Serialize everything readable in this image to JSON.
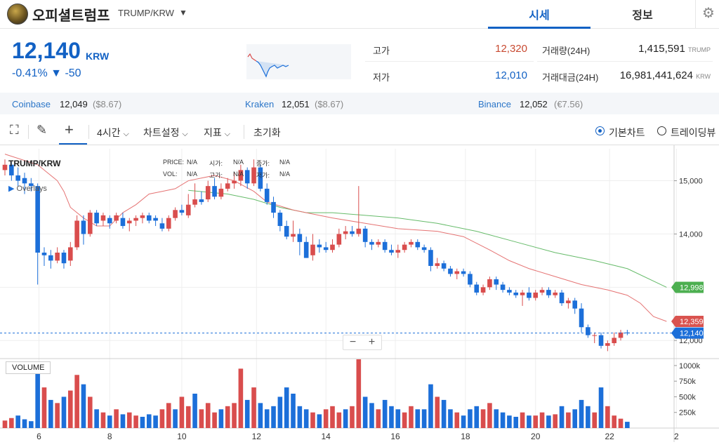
{
  "header": {
    "coin_name": "오피셜트럼프",
    "pair": "TRUMP/KRW",
    "tabs": [
      "시세",
      "정보"
    ]
  },
  "price": {
    "value": "12,140",
    "unit": "KRW",
    "change_pct": "-0.41%",
    "change_amt": "▼ -50"
  },
  "stats": {
    "high_label": "고가",
    "high": "12,320",
    "low_label": "저가",
    "low": "12,010",
    "vol_label": "거래량(24H)",
    "vol": "1,415,591",
    "vol_unit": "TRUMP",
    "amt_label": "거래대금(24H)",
    "amt": "16,981,441,624",
    "amt_unit": "KRW"
  },
  "exchanges": [
    {
      "name": "Coinbase",
      "price": "12,049",
      "usd": "($8.67)"
    },
    {
      "name": "Kraken",
      "price": "12,051",
      "usd": "($8.67)"
    },
    {
      "name": "Binance",
      "price": "12,052",
      "usd": "(€7.56)"
    }
  ],
  "toolbar": {
    "interval": "4시간",
    "chart_settings": "차트설정",
    "indicators": "지표",
    "reset": "초기화",
    "basic_chart": "기본차트",
    "trading_view": "트레이딩뷰"
  },
  "chart_overlay": {
    "pair": "TRUMP/KRW",
    "overlays": "Overlays",
    "price_label": "PRICE:",
    "price_val": "N/A",
    "open_label": "시가:",
    "open_val": "N/A",
    "close_label": "종가:",
    "close_val": "N/A",
    "vol_label": "VOL:",
    "vol_val": "N/A",
    "high_label": "고가:",
    "high_val": "N/A",
    "low_label": "저가:",
    "low_val": "N/A",
    "volume_title": "VOLUME",
    "zoom_minus": "−",
    "zoom_plus": "+"
  },
  "colors": {
    "up": "#d94d4d",
    "down": "#1c6fd9",
    "ma_short": "#e57373",
    "ma_long": "#66bb6a",
    "accent": "#1261c4"
  },
  "chart_data": {
    "type": "candlestick",
    "x_ticks": [
      "6",
      "8",
      "10",
      "12",
      "14",
      "16",
      "18",
      "20",
      "22",
      "2"
    ],
    "y_ticks": [
      "15,000",
      "14,000",
      "12,000"
    ],
    "volume_ticks": [
      "1000k",
      "750k",
      "500k",
      "250k"
    ],
    "ylim": [
      11700,
      15600
    ],
    "markers": {
      "ma_long": "12,998",
      "ma_short": "12,359",
      "current": "12,140"
    },
    "ma_short_points": [
      [
        0,
        15500
      ],
      [
        5,
        15300
      ],
      [
        8,
        15000
      ],
      [
        9,
        14800
      ],
      [
        10,
        14500
      ],
      [
        12,
        14300
      ],
      [
        14,
        14150
      ],
      [
        16,
        14150
      ],
      [
        18,
        14400
      ],
      [
        20,
        14550
      ],
      [
        22,
        14750
      ],
      [
        24,
        14800
      ],
      [
        26,
        14850
      ],
      [
        28,
        15000
      ],
      [
        32,
        15100
      ],
      [
        35,
        15000
      ],
      [
        38,
        14800
      ],
      [
        40,
        14600
      ],
      [
        44,
        14450
      ],
      [
        46,
        14400
      ],
      [
        50,
        14300
      ],
      [
        55,
        14200
      ],
      [
        60,
        14100
      ],
      [
        66,
        14050
      ],
      [
        70,
        13950
      ],
      [
        74,
        13700
      ],
      [
        77,
        13500
      ],
      [
        80,
        13350
      ],
      [
        84,
        13200
      ],
      [
        88,
        13050
      ],
      [
        92,
        12950
      ],
      [
        95,
        12850
      ],
      [
        97,
        12700
      ],
      [
        99,
        12450
      ],
      [
        101,
        12359
      ]
    ],
    "ma_long_points": [
      [
        28,
        14820
      ],
      [
        34,
        14750
      ],
      [
        38,
        14650
      ],
      [
        42,
        14500
      ],
      [
        46,
        14400
      ],
      [
        50,
        14400
      ],
      [
        55,
        14350
      ],
      [
        60,
        14300
      ],
      [
        66,
        14200
      ],
      [
        72,
        14050
      ],
      [
        78,
        13850
      ],
      [
        84,
        13650
      ],
      [
        90,
        13500
      ],
      [
        95,
        13350
      ],
      [
        101,
        12998
      ]
    ],
    "candles": [
      [
        15200,
        15300,
        15400,
        15100
      ],
      [
        15300,
        15100,
        15350,
        15000
      ],
      [
        15100,
        15000,
        15250,
        14900
      ],
      [
        15050,
        14950,
        15150,
        14750
      ],
      [
        14950,
        14900,
        15050,
        14800
      ],
      [
        14900,
        13650,
        14950,
        13050
      ],
      [
        13650,
        13600,
        13750,
        13400
      ],
      [
        13600,
        13500,
        13700,
        13350
      ],
      [
        13500,
        13650,
        13750,
        13450
      ],
      [
        13650,
        13450,
        13700,
        13350
      ],
      [
        13500,
        13750,
        13850,
        13400
      ],
      [
        13750,
        14250,
        14350,
        13700
      ],
      [
        14250,
        14000,
        14350,
        13800
      ],
      [
        14000,
        14400,
        14450,
        13950
      ],
      [
        14400,
        14200,
        14450,
        14150
      ],
      [
        14250,
        14350,
        14400,
        14150
      ],
      [
        14300,
        14200,
        14350,
        14100
      ],
      [
        14250,
        14350,
        14400,
        14200
      ],
      [
        14300,
        14150,
        14400,
        14100
      ],
      [
        14200,
        14250,
        14300,
        14050
      ],
      [
        14250,
        14300,
        14350,
        14150
      ],
      [
        14300,
        14350,
        14400,
        14200
      ],
      [
        14350,
        14250,
        14400,
        14200
      ],
      [
        14300,
        14250,
        14350,
        14150
      ],
      [
        14200,
        14100,
        14300,
        14050
      ],
      [
        14100,
        14300,
        14350,
        14050
      ],
      [
        14300,
        14450,
        14500,
        14250
      ],
      [
        14450,
        14400,
        14550,
        14350
      ],
      [
        14350,
        14550,
        14750,
        14300
      ],
      [
        14550,
        14650,
        14950,
        14500
      ],
      [
        14650,
        14600,
        14800,
        14550
      ],
      [
        14650,
        14900,
        15000,
        14600
      ],
      [
        14900,
        14700,
        15050,
        14650
      ],
      [
        14700,
        14850,
        14950,
        14650
      ],
      [
        14850,
        14950,
        15050,
        14800
      ],
      [
        14950,
        15000,
        15150,
        14850
      ],
      [
        15000,
        15200,
        15300,
        14900
      ],
      [
        15200,
        14950,
        15250,
        14850
      ],
      [
        14950,
        15250,
        15400,
        14900
      ],
      [
        15250,
        14850,
        15300,
        14800
      ],
      [
        14850,
        14600,
        14950,
        14550
      ],
      [
        14600,
        14400,
        14700,
        14300
      ],
      [
        14400,
        14150,
        14450,
        14050
      ],
      [
        14150,
        13950,
        14250,
        13900
      ],
      [
        13950,
        14000,
        14250,
        13850
      ],
      [
        14000,
        13850,
        14100,
        13600
      ],
      [
        13850,
        13550,
        13950,
        13550
      ],
      [
        13600,
        13800,
        14000,
        13500
      ],
      [
        13800,
        13750,
        13900,
        13650
      ],
      [
        13750,
        13700,
        13850,
        13650
      ],
      [
        13700,
        13800,
        13900,
        13650
      ],
      [
        13800,
        14000,
        14100,
        13750
      ],
      [
        14000,
        14050,
        14150,
        13900
      ],
      [
        14050,
        14000,
        14150,
        13950
      ],
      [
        14000,
        14100,
        14900,
        13950
      ],
      [
        14100,
        13850,
        14150,
        13750
      ],
      [
        13850,
        13800,
        13900,
        13700
      ],
      [
        13800,
        13850,
        13900,
        13750
      ],
      [
        13850,
        13700,
        13900,
        13650
      ],
      [
        13700,
        13650,
        13800,
        13600
      ],
      [
        13650,
        13700,
        13800,
        13550
      ],
      [
        13700,
        13800,
        13850,
        13650
      ],
      [
        13800,
        13850,
        13900,
        13750
      ],
      [
        13850,
        13750,
        13900,
        13700
      ],
      [
        13750,
        13700,
        13800,
        13650
      ],
      [
        13700,
        13400,
        13750,
        13300
      ],
      [
        13400,
        13450,
        13550,
        13350
      ],
      [
        13450,
        13350,
        13500,
        13300
      ],
      [
        13350,
        13250,
        13400,
        13200
      ],
      [
        13250,
        13300,
        13350,
        13150
      ],
      [
        13300,
        13250,
        13350,
        13200
      ],
      [
        13250,
        13050,
        13300,
        13000
      ],
      [
        13050,
        12900,
        13100,
        12850
      ],
      [
        12900,
        13000,
        13050,
        12850
      ],
      [
        13000,
        13150,
        13200,
        12950
      ],
      [
        13150,
        13050,
        13200,
        12950
      ],
      [
        13050,
        12950,
        13100,
        12900
      ],
      [
        12950,
        12900,
        13000,
        12850
      ],
      [
        12900,
        12850,
        12950,
        12800
      ],
      [
        12850,
        12900,
        12950,
        12650
      ],
      [
        12900,
        12800,
        13000,
        12750
      ],
      [
        12800,
        12900,
        12950,
        12750
      ],
      [
        12900,
        12950,
        13000,
        12850
      ],
      [
        12950,
        12850,
        13000,
        12800
      ],
      [
        12850,
        12900,
        12950,
        12800
      ],
      [
        12900,
        12700,
        12950,
        12650
      ],
      [
        12700,
        12750,
        12800,
        12600
      ],
      [
        12750,
        12600,
        12800,
        12500
      ],
      [
        12600,
        12250,
        12700,
        12150
      ],
      [
        12250,
        12100,
        12300,
        12050
      ],
      [
        12100,
        12100,
        12150,
        11950
      ],
      [
        12100,
        11900,
        12150,
        11850
      ],
      [
        11900,
        11950,
        12000,
        11800
      ],
      [
        11950,
        12050,
        12150,
        11900
      ],
      [
        12050,
        12150,
        12200,
        12000
      ],
      [
        12150,
        12140,
        12200,
        12100
      ]
    ],
    "volumes": [
      [
        120,
        1
      ],
      [
        160,
        1
      ],
      [
        200,
        0
      ],
      [
        140,
        0
      ],
      [
        110,
        0
      ],
      [
        1000,
        0
      ],
      [
        650,
        1
      ],
      [
        450,
        0
      ],
      [
        400,
        1
      ],
      [
        500,
        0
      ],
      [
        600,
        1
      ],
      [
        850,
        1
      ],
      [
        700,
        0
      ],
      [
        500,
        1
      ],
      [
        300,
        0
      ],
      [
        250,
        1
      ],
      [
        200,
        0
      ],
      [
        300,
        1
      ],
      [
        220,
        0
      ],
      [
        250,
        1
      ],
      [
        200,
        1
      ],
      [
        180,
        0
      ],
      [
        220,
        0
      ],
      [
        200,
        0
      ],
      [
        300,
        1
      ],
      [
        400,
        1
      ],
      [
        300,
        0
      ],
      [
        500,
        1
      ],
      [
        350,
        1
      ],
      [
        550,
        0
      ],
      [
        300,
        1
      ],
      [
        400,
        1
      ],
      [
        250,
        1
      ],
      [
        300,
        0
      ],
      [
        350,
        1
      ],
      [
        400,
        1
      ],
      [
        950,
        1
      ],
      [
        450,
        0
      ],
      [
        650,
        1
      ],
      [
        400,
        0
      ],
      [
        300,
        0
      ],
      [
        350,
        0
      ],
      [
        500,
        0
      ],
      [
        650,
        0
      ],
      [
        550,
        0
      ],
      [
        350,
        0
      ],
      [
        300,
        0
      ],
      [
        250,
        1
      ],
      [
        220,
        0
      ],
      [
        300,
        1
      ],
      [
        350,
        1
      ],
      [
        250,
        1
      ],
      [
        300,
        0
      ],
      [
        350,
        1
      ],
      [
        1100,
        1
      ],
      [
        500,
        0
      ],
      [
        400,
        0
      ],
      [
        300,
        1
      ],
      [
        450,
        0
      ],
      [
        350,
        0
      ],
      [
        300,
        0
      ],
      [
        250,
        1
      ],
      [
        350,
        1
      ],
      [
        300,
        0
      ],
      [
        300,
        0
      ],
      [
        700,
        0
      ],
      [
        500,
        1
      ],
      [
        450,
        0
      ],
      [
        300,
        0
      ],
      [
        250,
        1
      ],
      [
        200,
        0
      ],
      [
        300,
        0
      ],
      [
        350,
        0
      ],
      [
        300,
        1
      ],
      [
        400,
        1
      ],
      [
        300,
        0
      ],
      [
        250,
        0
      ],
      [
        200,
        0
      ],
      [
        180,
        0
      ],
      [
        250,
        1
      ],
      [
        200,
        0
      ],
      [
        200,
        1
      ],
      [
        250,
        1
      ],
      [
        200,
        0
      ],
      [
        220,
        1
      ],
      [
        350,
        0
      ],
      [
        250,
        1
      ],
      [
        300,
        0
      ],
      [
        450,
        0
      ],
      [
        350,
        0
      ],
      [
        250,
        1
      ],
      [
        650,
        0
      ],
      [
        350,
        1
      ],
      [
        200,
        1
      ],
      [
        150,
        1
      ],
      [
        100,
        0
      ]
    ]
  }
}
